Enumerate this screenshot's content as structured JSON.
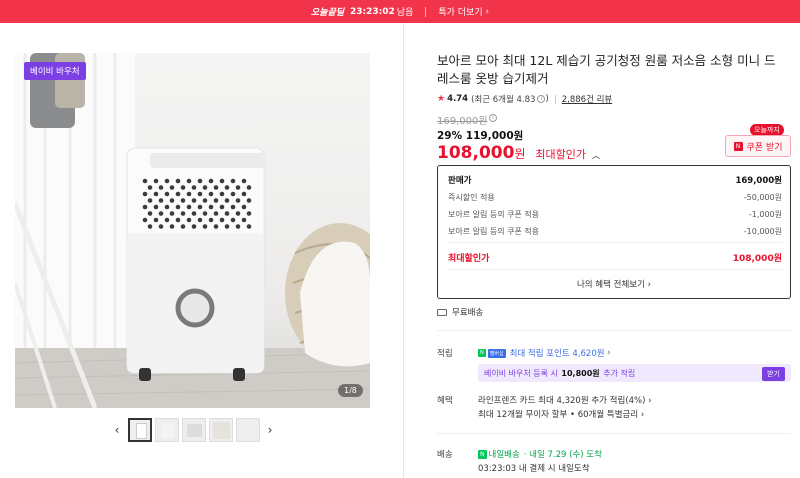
{
  "banner": {
    "deal_label": "오늘끝딜",
    "timer": "23:23:02",
    "remain": "남음",
    "more": "특가 더보기",
    "accent": "#f2344b"
  },
  "gallery": {
    "badge": "베이비 바우처",
    "counter": "1/8",
    "thumb_prev": "‹",
    "thumb_next": "›"
  },
  "product": {
    "title": "보아르 모아 최대 12L 제습기 공기청정 원룸 저소음 소형 미니 드레스룸 옷방 습기제거",
    "rating": "4.74",
    "recent": "(최근 6개월 4.83",
    "recent_close": ")",
    "reviews": "2,886건 리뷰",
    "original_price": "169,000원",
    "discount_pct": "29%",
    "discount_price": "119,000원",
    "final_price": "108,000",
    "won": "원",
    "final_label": "최대할인가",
    "today_tag": "오늘까지",
    "coupon_btn": "쿠폰 받기"
  },
  "price_box": {
    "sale_label": "판매가",
    "sale_value": "169,000원",
    "instant_label": "즉시할인 적용",
    "instant_value": "-50,000원",
    "coupon1_label": "보아르 알림 등의 쿠폰 적용",
    "coupon1_value": "-1,000원",
    "coupon2_label": "보아르 알림 등의 쿠폰 적용",
    "coupon2_value": "-10,000원",
    "max_label": "최대할인가",
    "max_value": "108,000원",
    "more": "나의 혜택 전체보기"
  },
  "shipping": {
    "free": "무료배송"
  },
  "points": {
    "label": "적립",
    "npay": "N",
    "mem": "멤버십",
    "text": "최대 적립 포인트 4,620원",
    "voucher_pre": "베이비 바우처 등록 시",
    "voucher_amt": "10,800원",
    "voucher_post": "추가 적립",
    "voucher_btn": "받기"
  },
  "benefit": {
    "label": "혜택",
    "line1": "라인프렌즈 카드 최대 4,320원 추가 적립(4%)",
    "line2": "최대 12개월 무이자 할부 • 60개월 특별금리"
  },
  "delivery": {
    "label": "배송",
    "badge": "N",
    "fast": "내일배송",
    "date": "· 내일 7.29 (수) 도착",
    "line2": "03:23:03  내 결제 시 내일도착"
  }
}
